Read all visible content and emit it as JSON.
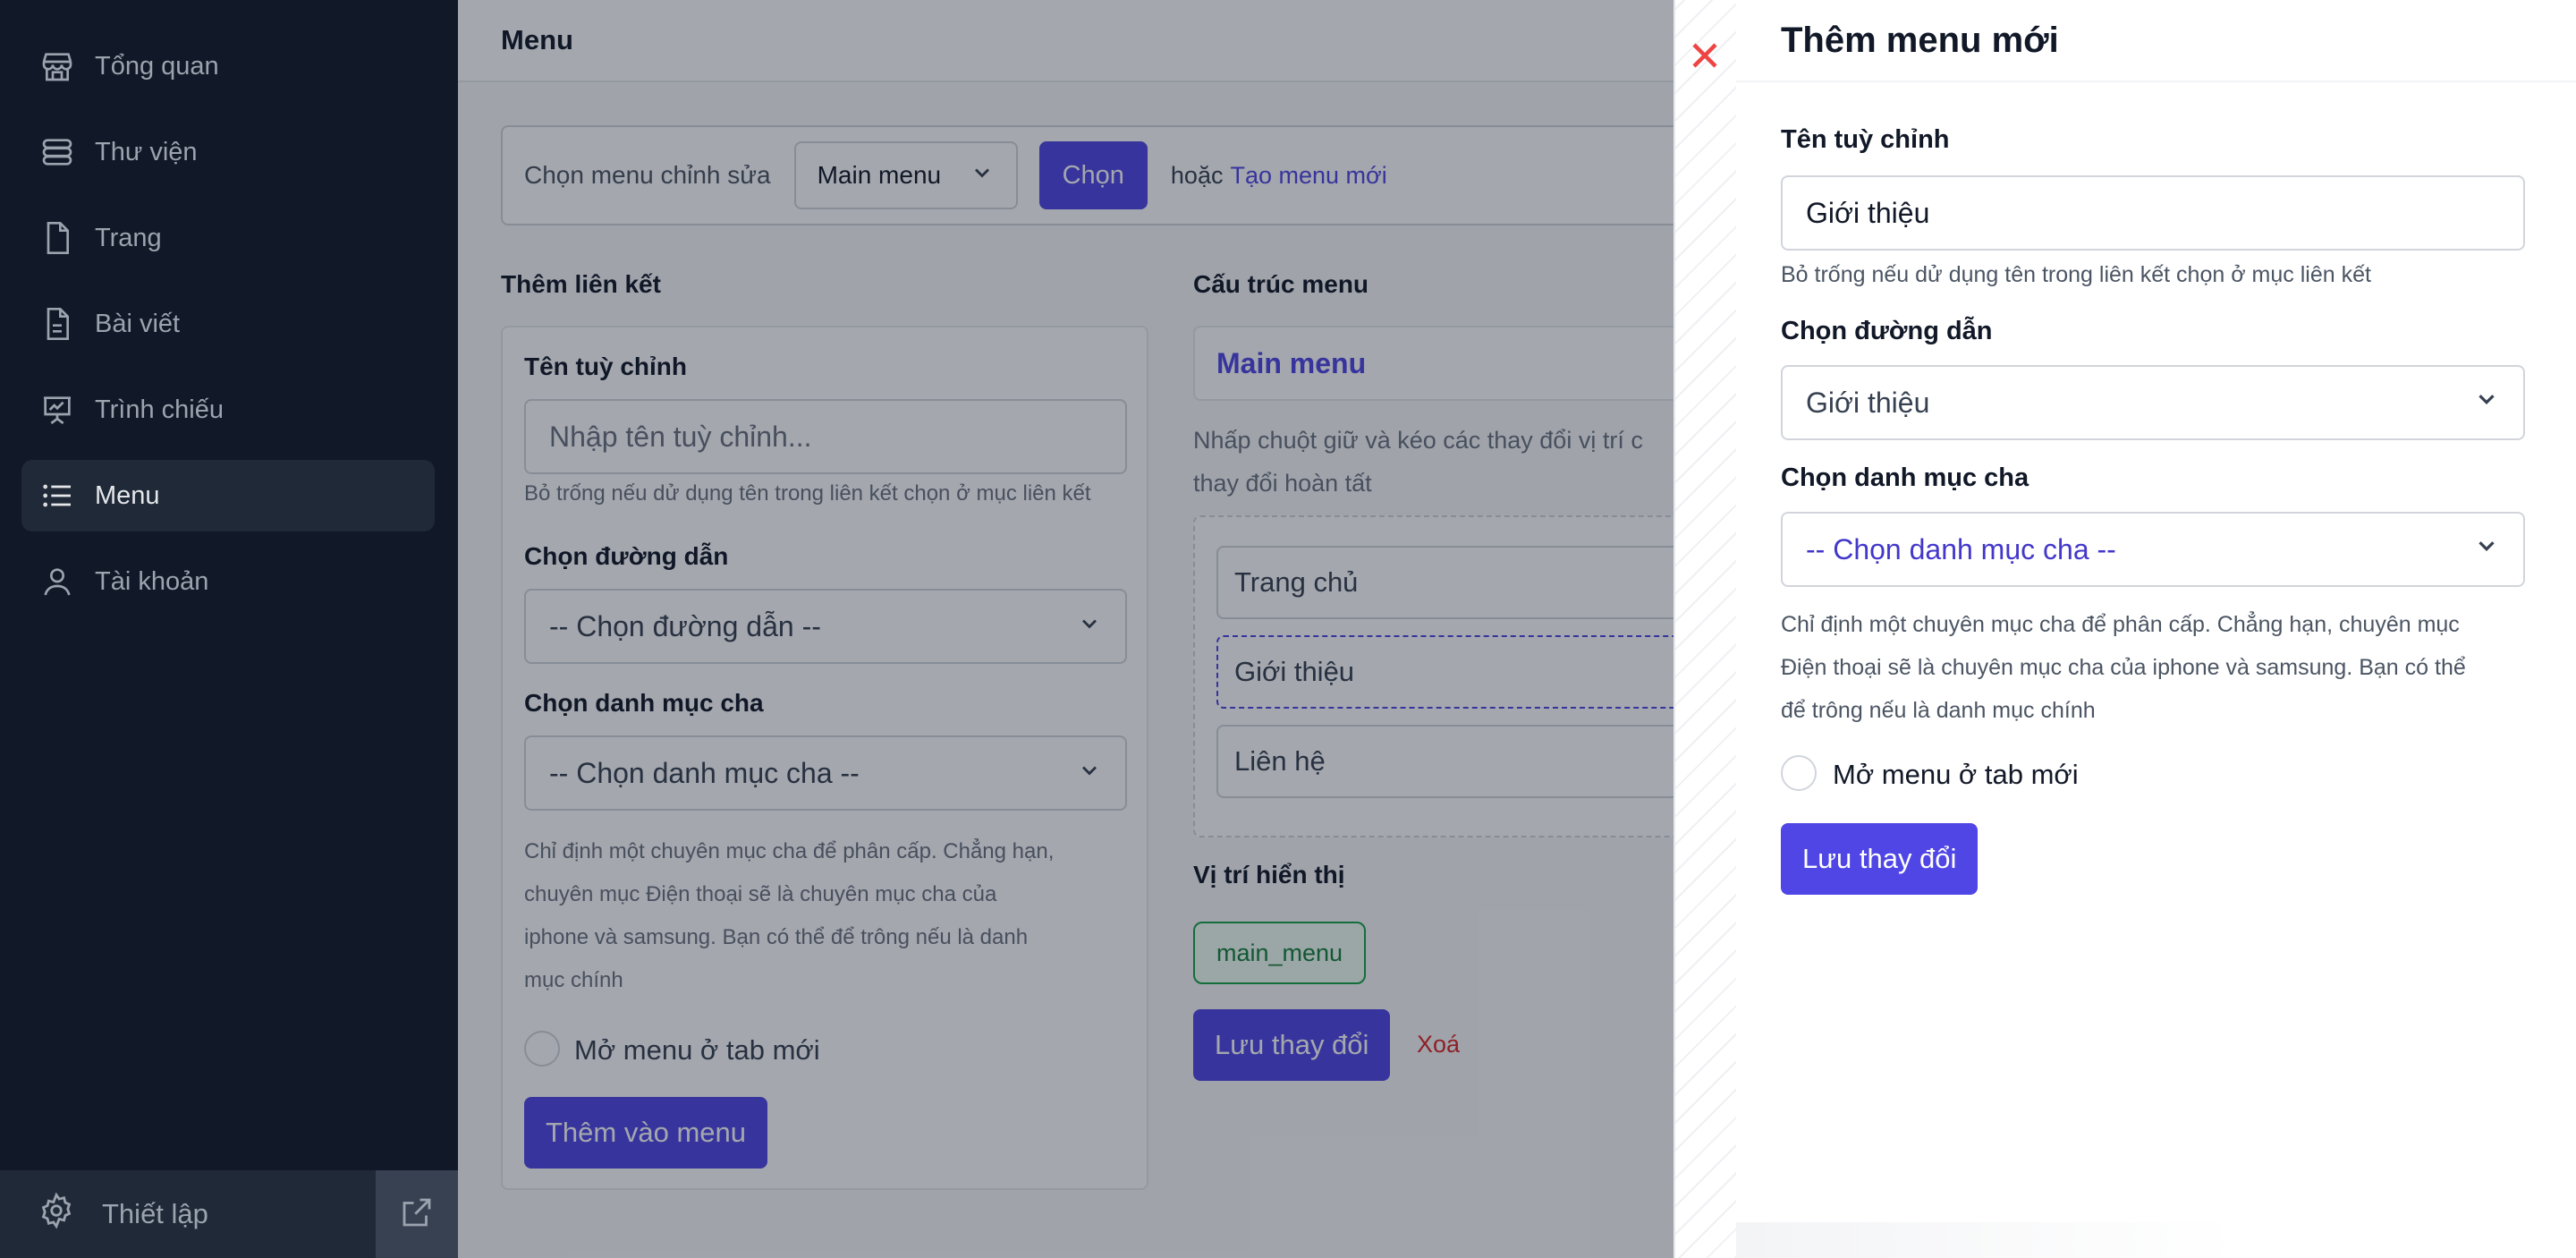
{
  "sidebar": {
    "items": [
      {
        "label": "Tổng quan",
        "icon": "store-icon"
      },
      {
        "label": "Thư viện",
        "icon": "database-icon"
      },
      {
        "label": "Trang",
        "icon": "file-icon"
      },
      {
        "label": "Bài viết",
        "icon": "document-text-icon"
      },
      {
        "label": "Trình chiếu",
        "icon": "presentation-chart-icon"
      },
      {
        "label": "Menu",
        "icon": "list-icon",
        "active": true
      },
      {
        "label": "Tài khoản",
        "icon": "user-icon"
      }
    ],
    "settings_label": "Thiết lập"
  },
  "header": {
    "title": "Menu"
  },
  "chooser": {
    "label": "Chọn menu chỉnh sửa",
    "selected": "Main menu",
    "choose_button": "Chọn",
    "or_text": "hoặc",
    "create_link": "Tạo menu mới"
  },
  "add_link": {
    "section_title": "Thêm liên kết",
    "custom_name_label": "Tên tuỳ chỉnh",
    "custom_name_placeholder": "Nhập tên tuỳ chỉnh...",
    "custom_name_hint": "Bỏ trống nếu dử dụng tên trong liên kết chọn ở mục liên kết",
    "path_label": "Chọn đường dẫn",
    "path_selected": "-- Chọn đường dẫn --",
    "parent_label": "Chọn danh mục cha",
    "parent_selected": "-- Chọn danh mục cha --",
    "parent_hint_lines": [
      "Chỉ định một chuyên mục cha để phân cấp. Chẳng hạn,",
      "chuyên mục Điện thoại sẽ là chuyên mục cha của",
      "iphone và samsung. Bạn có thể để trông nếu là danh",
      "mục chính"
    ],
    "new_tab_label": "Mở menu ở tab mới",
    "add_button": "Thêm vào menu"
  },
  "structure": {
    "section_title": "Cấu trúc menu",
    "menu_name": "Main menu",
    "hint_lines": [
      "Nhấp chuột giữ và kéo các thay đổi vị trí c",
      "thay đổi hoàn tất"
    ],
    "items": [
      "Trang chủ",
      "Giới thiệu",
      "Liên hệ"
    ],
    "location_title": "Vị trí hiển thị",
    "location_badge": "main_menu",
    "save_button": "Lưu thay đổi",
    "delete_link": "Xoá"
  },
  "drawer": {
    "title": "Thêm menu mới",
    "custom_name_label": "Tên tuỳ chỉnh",
    "custom_name_value": "Giới thiệu",
    "custom_name_hint": "Bỏ trống nếu dử dụng tên trong liên kết chọn ở mục liên kết",
    "path_label": "Chọn đường dẫn",
    "path_selected": "Giới thiệu",
    "parent_label": "Chọn danh mục cha",
    "parent_selected": "-- Chọn danh mục cha --",
    "parent_hint_lines": [
      "Chỉ định một chuyên mục cha để phân cấp. Chẳng hạn, chuyên mục",
      "Điện thoại sẽ là chuyên mục cha của iphone và samsung. Bạn có thể",
      "để trông nếu là danh mục chính"
    ],
    "new_tab_label": "Mở menu ở tab mới",
    "save_button": "Lưu thay đổi"
  },
  "colors": {
    "accent": "#4f46e5",
    "sidebar_bg": "#111827",
    "danger": "#dc2626",
    "success": "#16a34a"
  }
}
